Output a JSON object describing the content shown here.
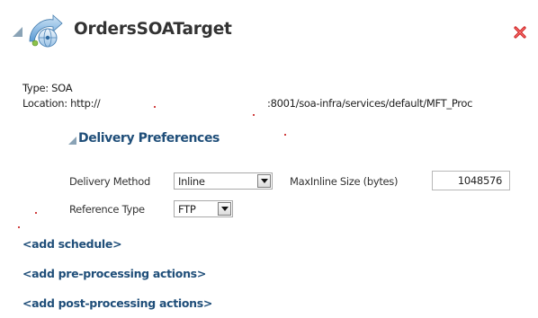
{
  "header": {
    "title": "OrdersSOATarget",
    "toggle_icon": "expanded-triangle-icon",
    "target_icon": "soa-target-icon",
    "close_icon": "delete-x-icon",
    "colors": {
      "title": "#333333",
      "close": "#cc2222",
      "icon_primary": "#5b9bd5"
    }
  },
  "info": {
    "type_line": "Type: SOA",
    "location_prefix": "Location: http://",
    "location_suffix": ":8001/soa-infra/services/default/MFT_Proc"
  },
  "delivery_preferences": {
    "title": "Delivery Preferences",
    "toggle_icon": "expanded-triangle-icon",
    "delivery_method": {
      "label": "Delivery Method",
      "value": "Inline"
    },
    "max_inline_size": {
      "label": "MaxInline Size (bytes)",
      "value": "1048576"
    },
    "reference_type": {
      "label": "Reference Type",
      "value": "FTP"
    }
  },
  "links": {
    "add_schedule": "<add schedule>",
    "add_pre_processing": "<add pre-processing actions>",
    "add_post_processing": "<add post-processing actions>"
  },
  "colors": {
    "link": "#1f4e79",
    "section_title": "#1f4e79"
  }
}
